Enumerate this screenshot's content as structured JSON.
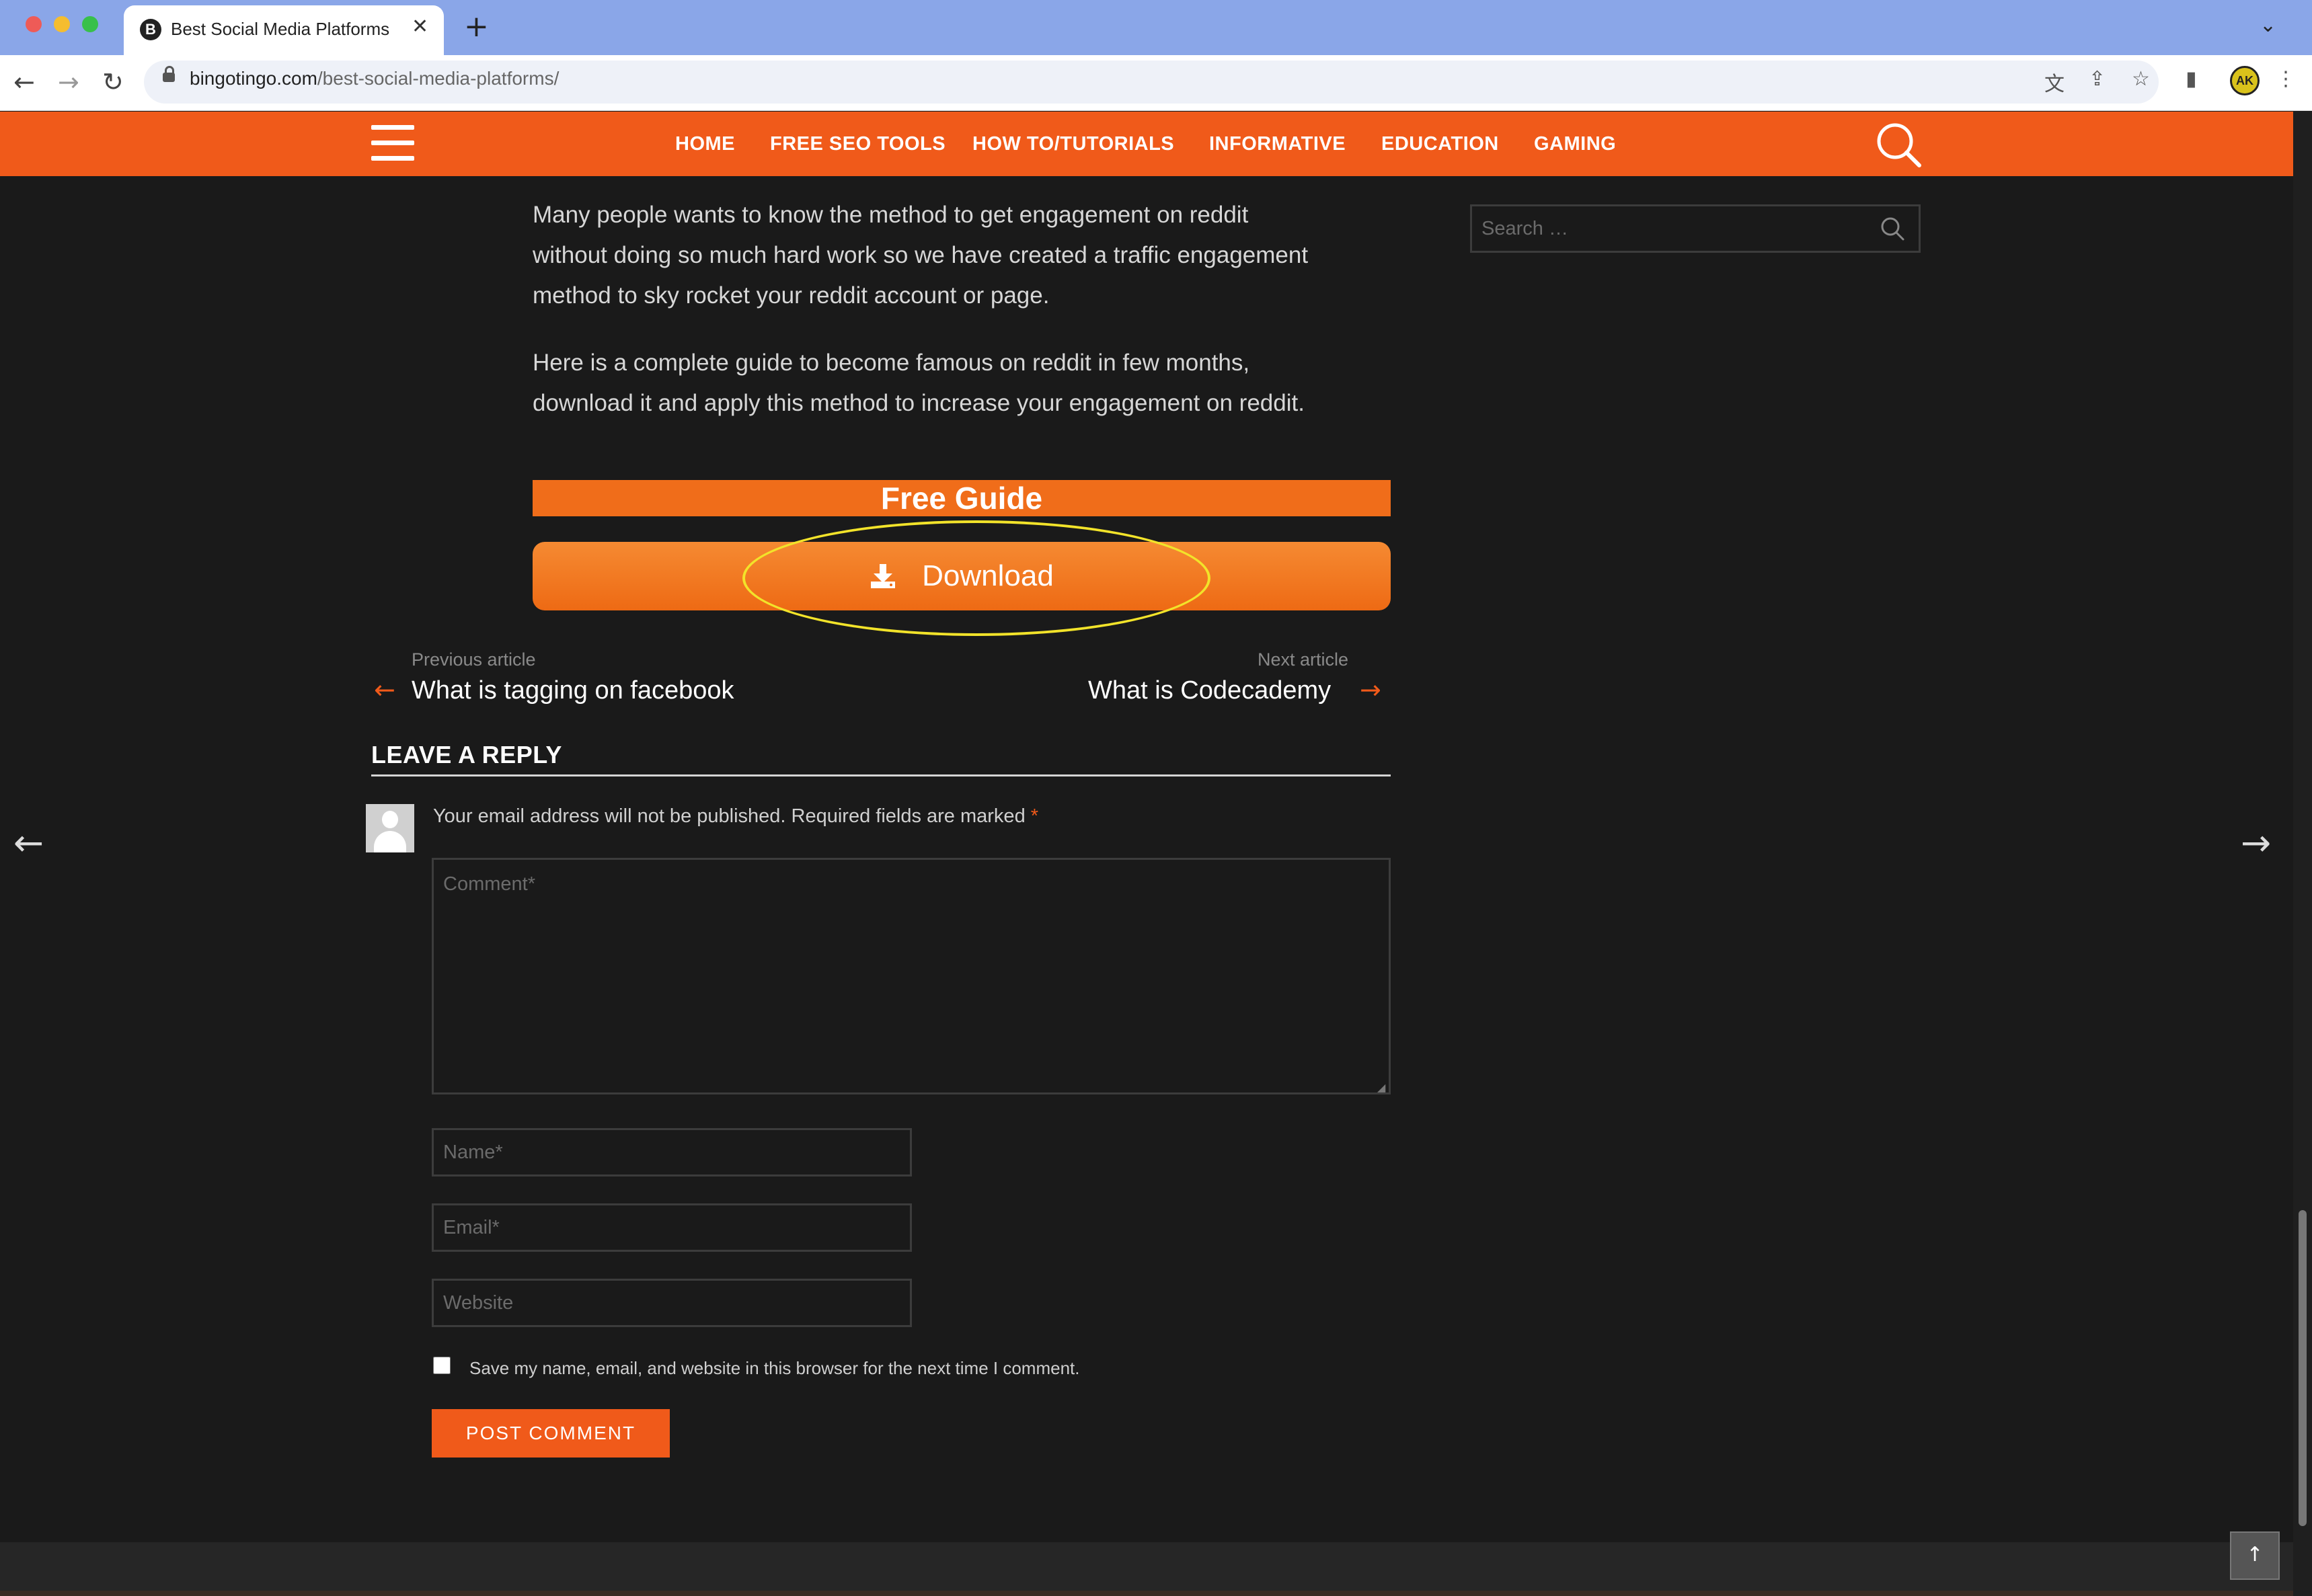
{
  "browser": {
    "tab_title": "Best Social Media Platforms | B",
    "favicon_letter": "B",
    "url_domain": "bingotingo.com",
    "url_path": "/best-social-media-platforms/",
    "profile_initials": "AK"
  },
  "nav": {
    "items": [
      "HOME",
      "FREE SEO TOOLS",
      "HOW TO/TUTORIALS",
      "INFORMATIVE",
      "EDUCATION",
      "GAMING"
    ]
  },
  "article": {
    "paragraph1_lines": [
      "Many people wants to know the method to get engagement on reddit",
      "without doing so much hard work so we have created a traffic engagement",
      "method to sky rocket your reddit account or page."
    ],
    "paragraph2_lines": [
      "Here is a complete guide to become famous on reddit in few months,",
      "download it and apply this method to increase your engagement on reddit."
    ],
    "free_guide_label": "Free Guide",
    "download_label": "Download"
  },
  "post_nav": {
    "prev_small": "Previous article",
    "prev_title": "What is tagging on facebook",
    "next_small": "Next article",
    "next_title": "What is Codecademy"
  },
  "reply": {
    "title": "LEAVE A REPLY",
    "notice": "Your email address will not be published. Required fields are marked",
    "required_mark": "*",
    "comment_placeholder": "Comment*",
    "name_placeholder": "Name*",
    "email_placeholder": "Email*",
    "website_placeholder": "Website",
    "save_label": "Save my name, email, and website in this browser for the next time I comment.",
    "save_checked": false,
    "submit_label": "POST COMMENT"
  },
  "sidebar": {
    "search_placeholder": "Search …"
  },
  "colors": {
    "accent": "#f05a1a",
    "highlight_ellipse": "#f2e32a",
    "background": "#1a1a1a"
  }
}
